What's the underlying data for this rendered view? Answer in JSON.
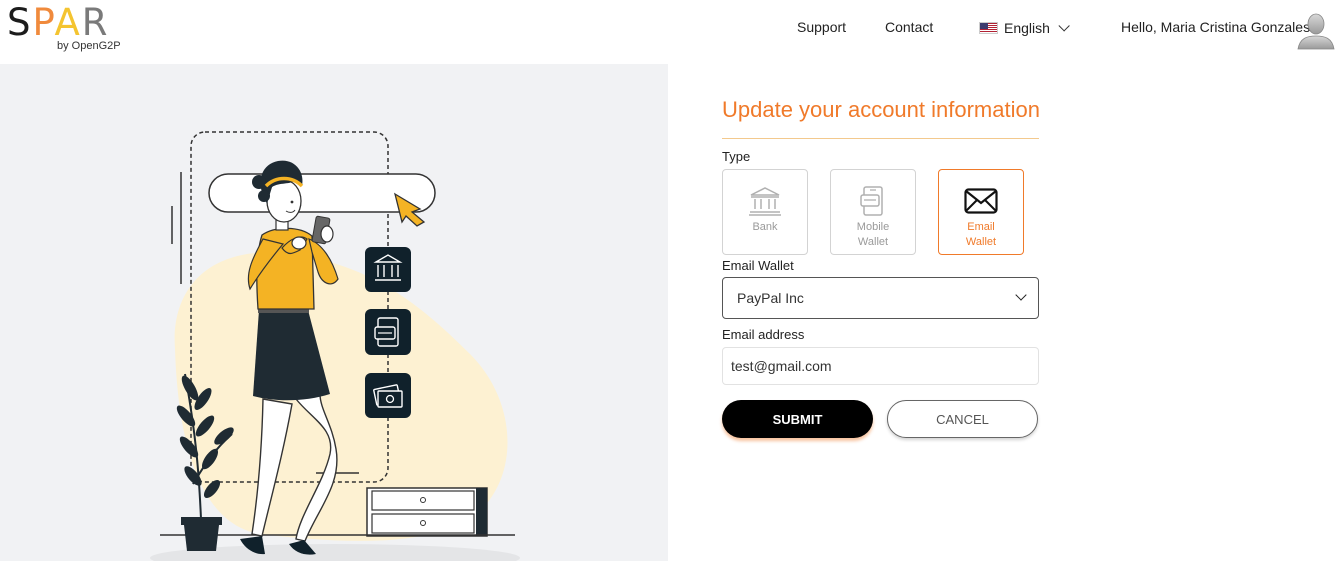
{
  "brand": {
    "logo_letters": [
      "S",
      "P",
      "A",
      "R"
    ],
    "subtitle": "by OpenG2P",
    "colors": {
      "orange": "#f07a2a",
      "yellow": "#f4c430",
      "dark": "#000000"
    }
  },
  "header": {
    "nav": {
      "support": "Support",
      "contact": "Contact"
    },
    "language": {
      "label": "English",
      "flag_icon": "us-flag-icon"
    },
    "greeting": "Hello, Maria Cristina Gonzales",
    "avatar_icon": "user-avatar-icon"
  },
  "illustration": {
    "description_icons": [
      "bank-icon",
      "mobile-wallet-icon",
      "cash-icon"
    ]
  },
  "form": {
    "title": "Update your account information",
    "type_label": "Type",
    "types": [
      {
        "label_line1": "Bank",
        "label_line2": "",
        "icon": "bank-icon",
        "selected": false
      },
      {
        "label_line1": "Mobile",
        "label_line2": "Wallet",
        "icon": "mobile-wallet-icon",
        "selected": false
      },
      {
        "label_line1": "Email",
        "label_line2": "Wallet",
        "icon": "envelope-icon",
        "selected": true
      }
    ],
    "wallet_label": "Email Wallet",
    "wallet_value": "PayPal Inc",
    "email_label": "Email address",
    "email_value": "test@gmail.com",
    "submit_label": "SUBMIT",
    "cancel_label": "CANCEL"
  }
}
